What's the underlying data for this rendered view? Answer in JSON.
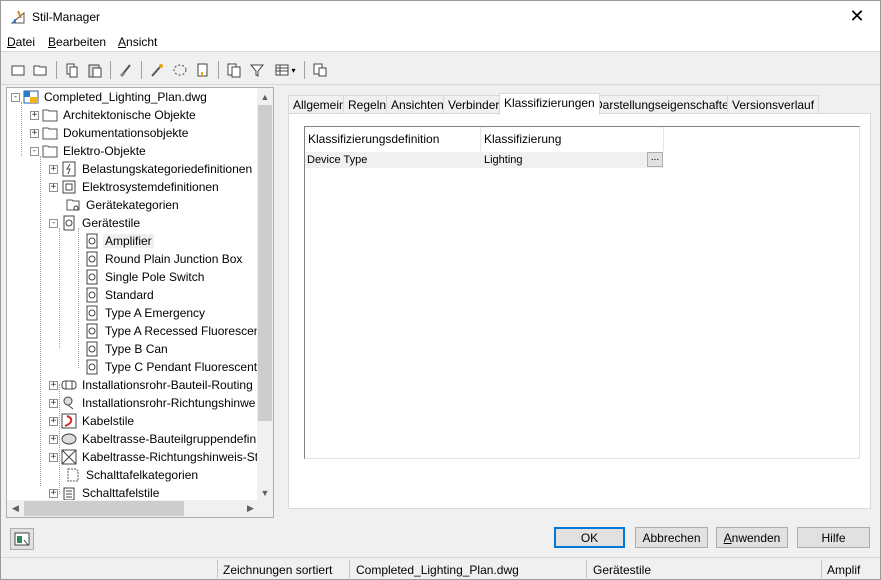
{
  "window": {
    "title": "Stil-Manager"
  },
  "menu": [
    {
      "label": "Datei",
      "u": "D",
      "rest": "atei"
    },
    {
      "label": "Bearbeiten",
      "u": "B",
      "rest": "earbeiten"
    },
    {
      "label": "Ansicht",
      "u": "A",
      "rest": "nsicht"
    }
  ],
  "tree": {
    "root": "Completed_Lighting_Plan.dwg",
    "items": [
      "Architektonische Objekte",
      "Dokumentationsobjekte",
      "Elektro-Objekte",
      "Belastungskategoriedefinitionen",
      "Elektrosystemdefinitionen",
      "Gerätekategorien",
      "Gerätestile",
      "Amplifier",
      "Round Plain Junction Box",
      "Single Pole Switch",
      "Standard",
      "Type A Emergency",
      "Type A Recessed Fluorescent",
      "Type B Can",
      "Type C Pendant Fluorescent",
      "Installationsrohr-Bauteil-Routing",
      "Installationsrohr-Richtungshinwe",
      "Kabelstile",
      "Kabeltrasse-Bauteilgruppendefin",
      "Kabeltrasse-Richtungshinweis-St",
      "Schalttafelkategorien",
      "Schalttafelstile"
    ],
    "selected": "Amplifier"
  },
  "tabs": [
    "Allgemein",
    "Regeln",
    "Ansichten",
    "Verbinder",
    "Klassifizierungen",
    "Darstellungseigenschaften",
    "Versionsverlauf"
  ],
  "active_tab": "Klassifizierungen",
  "grid": {
    "headers": [
      "Klassifizierungsdefinition",
      "Klassifizierung"
    ],
    "rows": [
      {
        "definition": "Device Type",
        "classification": "Lighting",
        "button": "..."
      }
    ]
  },
  "buttons": {
    "ok": "OK",
    "cancel": "Abbrechen",
    "apply_u": "A",
    "apply_rest": "nwenden",
    "help": "Hilfe"
  },
  "status": {
    "sort": "Zeichnungen sortiert",
    "drawing": "Completed_Lighting_Plan.dwg",
    "category": "Gerätestile",
    "last": "Amplif"
  },
  "colors": {
    "accent": "#0078d7",
    "selection_bg": "#f0f0f0"
  }
}
